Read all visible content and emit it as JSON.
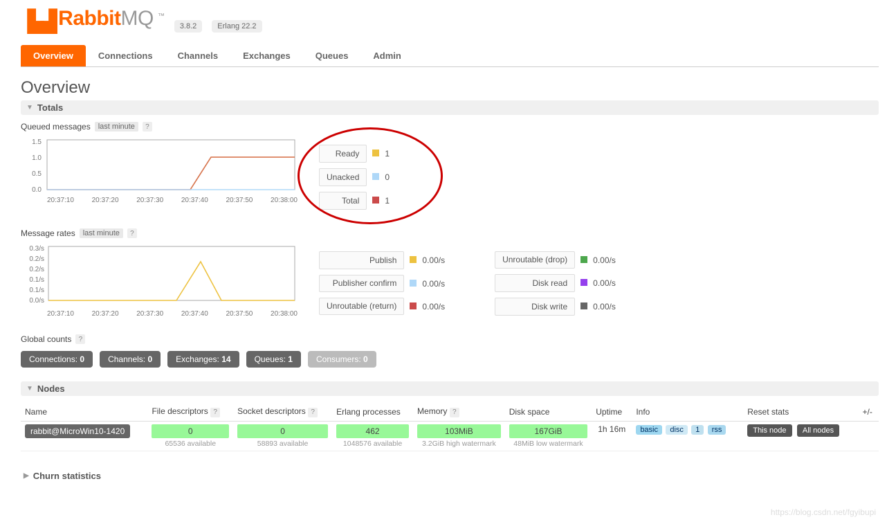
{
  "brand": {
    "name": "Rabbit",
    "suffix": "MQ",
    "version": "3.8.2",
    "erlang": "Erlang 22.2"
  },
  "tabs": [
    "Overview",
    "Connections",
    "Channels",
    "Exchanges",
    "Queues",
    "Admin"
  ],
  "active_tab": 0,
  "page_title": "Overview",
  "sections": {
    "totals": "Totals",
    "nodes": "Nodes",
    "churn": "Churn statistics"
  },
  "queued": {
    "title": "Queued messages",
    "range": "last minute",
    "legend": [
      {
        "label": "Ready",
        "color": "#edc240",
        "value": "1"
      },
      {
        "label": "Unacked",
        "color": "#afd8f8",
        "value": "0"
      },
      {
        "label": "Total",
        "color": "#cb4b4b",
        "value": "1"
      }
    ]
  },
  "rates": {
    "title": "Message rates",
    "range": "last minute",
    "legend_a": [
      {
        "label": "Publish",
        "color": "#edc240",
        "value": "0.00/s"
      },
      {
        "label": "Publisher confirm",
        "color": "#afd8f8",
        "value": "0.00/s"
      },
      {
        "label": "Unroutable (return)",
        "color": "#cb4b4b",
        "value": "0.00/s"
      }
    ],
    "legend_b": [
      {
        "label": "Unroutable (drop)",
        "color": "#4da74d",
        "value": "0.00/s"
      },
      {
        "label": "Disk read",
        "color": "#9440ed",
        "value": "0.00/s"
      },
      {
        "label": "Disk write",
        "color": "#666666",
        "value": "0.00/s"
      }
    ]
  },
  "global_counts": {
    "title": "Global counts",
    "items": [
      {
        "label": "Connections:",
        "value": "0",
        "light": false
      },
      {
        "label": "Channels:",
        "value": "0",
        "light": false
      },
      {
        "label": "Exchanges:",
        "value": "14",
        "light": false
      },
      {
        "label": "Queues:",
        "value": "1",
        "light": false
      },
      {
        "label": "Consumers:",
        "value": "0",
        "light": true
      }
    ]
  },
  "node_headers": [
    "Name",
    "File descriptors",
    "Socket descriptors",
    "Erlang processes",
    "Memory",
    "Disk space",
    "Uptime",
    "Info",
    "Reset stats",
    "+/-"
  ],
  "node": {
    "name": "rabbit@MicroWin10-1420",
    "fd": {
      "value": "0",
      "sub": "65536 available"
    },
    "sd": {
      "value": "0",
      "sub": "58893 available"
    },
    "ep": {
      "value": "462",
      "sub": "1048576 available"
    },
    "mem": {
      "value": "103MiB",
      "sub": "3.2GiB high watermark"
    },
    "dsk": {
      "value": "167GiB",
      "sub": "48MiB low watermark"
    },
    "uptime": "1h 16m",
    "info": [
      "basic",
      "disc",
      "1",
      "rss"
    ],
    "reset_this": "This node",
    "reset_all": "All nodes"
  },
  "watermark": "https://blog.csdn.net/fgyibupi",
  "chart_data": [
    {
      "type": "line",
      "title": "Queued messages",
      "x_ticks": [
        "20:37:10",
        "20:37:20",
        "20:37:30",
        "20:37:40",
        "20:37:50",
        "20:38:00"
      ],
      "ylim": [
        0,
        1.5
      ],
      "y_ticks": [
        0.0,
        0.5,
        1.0,
        1.5
      ],
      "series": [
        {
          "name": "Total",
          "color": "#cb4b4b",
          "values": [
            0,
            0,
            0,
            0,
            1,
            1,
            1
          ]
        },
        {
          "name": "Ready",
          "color": "#edc240",
          "values": [
            0,
            0,
            0,
            0,
            1,
            1,
            1
          ]
        },
        {
          "name": "Unacked",
          "color": "#afd8f8",
          "values": [
            0,
            0,
            0,
            0,
            0,
            0,
            0
          ]
        }
      ]
    },
    {
      "type": "line",
      "title": "Message rates",
      "x_ticks": [
        "20:37:10",
        "20:37:20",
        "20:37:30",
        "20:37:40",
        "20:37:50",
        "20:38:00"
      ],
      "ylim": [
        0,
        0.3
      ],
      "y_ticks": [
        0.0,
        0.1,
        0.1,
        0.2,
        0.2,
        0.3
      ],
      "y_tick_labels": [
        "0.0/s",
        "0.1/s",
        "0.1/s",
        "0.2/s",
        "0.2/s",
        "0.3/s"
      ],
      "series": [
        {
          "name": "Publish",
          "color": "#edc240",
          "values": [
            0,
            0,
            0,
            0.2,
            0,
            0,
            0
          ]
        }
      ]
    }
  ]
}
